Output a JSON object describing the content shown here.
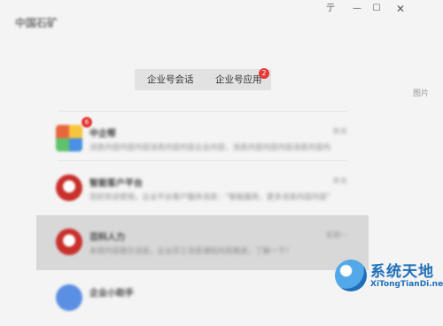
{
  "window": {
    "title": "中国石矿",
    "controls": {
      "pin": "亍",
      "minimize": "—",
      "maximize": "☐",
      "close": "✕"
    }
  },
  "tabs": [
    {
      "label": "企业号会话"
    },
    {
      "label": "企业号应用",
      "badge": "2"
    }
  ],
  "side_label": "图片",
  "conversations": [
    {
      "name": "中企帮",
      "preview": "消息内容内容内容消息内容内容企业内容，消息内容内容内容消息内容内",
      "time": "昨天",
      "badge": "6",
      "avatar": "colorful"
    },
    {
      "name": "智能客户平台",
      "preview": "您好欢迎使用，企业平台客户服务消息：“智能服务，更多消息内容内容”",
      "time": "昨天",
      "avatar": "red"
    },
    {
      "name": "百科人力",
      "preview": "本周内容提示消息，企业员工消息通知内容推送，了解一下！",
      "time": "星期一",
      "avatar": "red"
    },
    {
      "name": "企业小助手",
      "preview": "",
      "time": "",
      "avatar": "blue"
    }
  ],
  "watermark": {
    "title": "系统天地",
    "url": "XiTongTianDi.net"
  },
  "colors": {
    "badge_red": "#e53935",
    "selected_bg": "#d8d8d8",
    "watermark_blue": "#1f6fb8"
  }
}
